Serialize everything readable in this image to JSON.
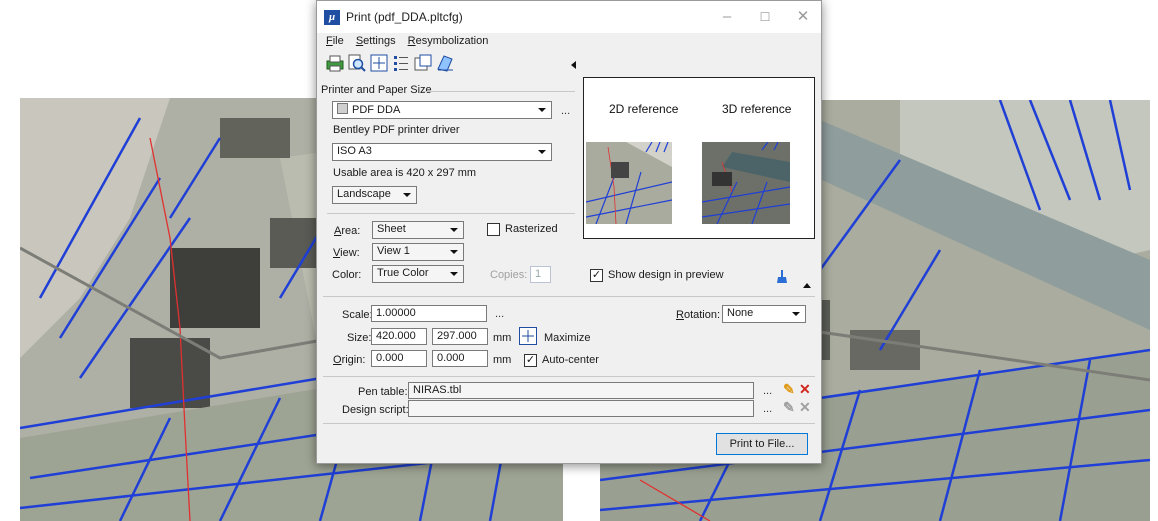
{
  "window": {
    "title": "Print (pdf_DDA.pltcfg)",
    "app_icon": "microstation-logo-icon",
    "controls": [
      "minimize-icon",
      "maximize-icon",
      "close-icon"
    ]
  },
  "menu": [
    "File",
    "Settings",
    "Resymbolization"
  ],
  "toolbar": [
    "printer-icon",
    "print-preview-icon",
    "fit-area-icon",
    "list-icon",
    "page-setup-icon",
    "printer-properties-icon"
  ],
  "printer_paper": {
    "group_label": "Printer and Paper Size",
    "printer": "PDF DDA",
    "driver": "Bentley PDF printer driver",
    "paper": "ISO A3",
    "usable_area": "Usable area is 420 x 297 mm",
    "orientation": "Landscape"
  },
  "preview": {
    "label_2d": "2D reference",
    "label_3d": "3D reference",
    "show_design_label": "Show design in preview",
    "show_design_checked": true
  },
  "area": {
    "area_label": "Area:",
    "area_value": "Sheet",
    "view_label": "View:",
    "view_value": "View 1",
    "color_label": "Color:",
    "color_value": "True Color",
    "copies_label": "Copies:",
    "copies_value": "1",
    "rasterized_label": "Rasterized",
    "rasterized_checked": false
  },
  "scale": {
    "scale_label": "Scale:",
    "scale_value": "1.00000",
    "rotation_label": "Rotation:",
    "rotation_value": "None",
    "size_label": "Size:",
    "size_x": "420.000",
    "size_y": "297.000",
    "size_unit": "mm",
    "maximize_label": "Maximize",
    "origin_label": "Origin:",
    "origin_x": "0.000",
    "origin_y": "0.000",
    "origin_unit": "mm",
    "autocenter_label": "Auto-center",
    "autocenter_checked": true
  },
  "tables": {
    "pen_table_label": "Pen table:",
    "pen_table_value": "NIRAS.tbl",
    "design_script_label": "Design script:",
    "design_script_value": ""
  },
  "actions": {
    "print_to_file": "Print to File..."
  },
  "colors": {
    "accent": "#0078d7",
    "map_lines": "#1f3fd6",
    "route": "#e03030",
    "delete": "#d0261c"
  }
}
